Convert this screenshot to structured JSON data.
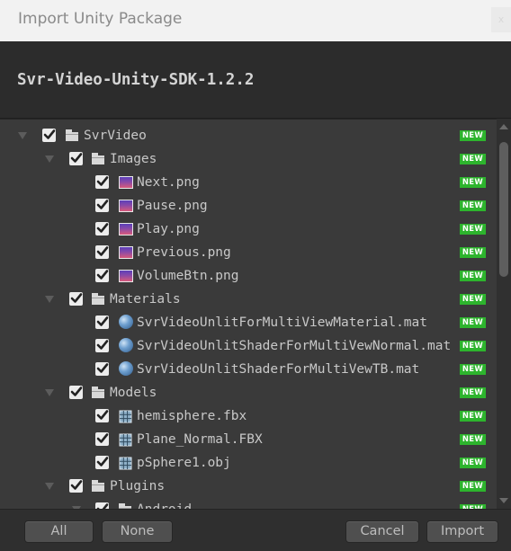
{
  "window": {
    "title": "Import Unity Package",
    "close_glyph": "x"
  },
  "package": {
    "name": "Svr-Video-Unity-SDK-1.2.2"
  },
  "badge": {
    "new_label": "NEW",
    "color": "#2db42d"
  },
  "tree": [
    {
      "label": "SvrVideo",
      "icon": "folder-icon",
      "depth": 0,
      "expanded": true,
      "checked": true,
      "new": true
    },
    {
      "label": "Images",
      "icon": "folder-icon",
      "depth": 1,
      "expanded": true,
      "checked": true,
      "new": true
    },
    {
      "label": "Next.png",
      "icon": "image-icon",
      "depth": 2,
      "checked": true,
      "new": true
    },
    {
      "label": "Pause.png",
      "icon": "image-icon",
      "depth": 2,
      "checked": true,
      "new": true
    },
    {
      "label": "Play.png",
      "icon": "image-icon",
      "depth": 2,
      "checked": true,
      "new": true
    },
    {
      "label": "Previous.png",
      "icon": "image-icon",
      "depth": 2,
      "checked": true,
      "new": true
    },
    {
      "label": "VolumeBtn.png",
      "icon": "image-icon",
      "depth": 2,
      "checked": true,
      "new": true
    },
    {
      "label": "Materials",
      "icon": "folder-icon",
      "depth": 1,
      "expanded": true,
      "checked": true,
      "new": true
    },
    {
      "label": "SvrVideoUnlitForMultiViewMaterial.mat",
      "icon": "material-sphere-icon",
      "depth": 2,
      "checked": true,
      "new": true
    },
    {
      "label": "SvrVideoUnlitShaderForMultiVewNormal.mat",
      "icon": "material-sphere-icon",
      "depth": 2,
      "checked": true,
      "new": true
    },
    {
      "label": "SvrVideoUnlitShaderForMultiVewTB.mat",
      "icon": "material-sphere-icon",
      "depth": 2,
      "checked": true,
      "new": true
    },
    {
      "label": "Models",
      "icon": "folder-icon",
      "depth": 1,
      "expanded": true,
      "checked": true,
      "new": true
    },
    {
      "label": "hemisphere.fbx",
      "icon": "mesh-icon",
      "depth": 2,
      "checked": true,
      "new": true
    },
    {
      "label": "Plane_Normal.FBX",
      "icon": "mesh-icon",
      "depth": 2,
      "checked": true,
      "new": true
    },
    {
      "label": "pSphere1.obj",
      "icon": "mesh-icon",
      "depth": 2,
      "checked": true,
      "new": true
    },
    {
      "label": "Plugins",
      "icon": "folder-icon",
      "depth": 1,
      "expanded": true,
      "checked": true,
      "new": true
    },
    {
      "label": "Android",
      "icon": "folder-icon",
      "depth": 2,
      "expanded": true,
      "checked": true,
      "new": true
    }
  ],
  "footer": {
    "all_label": "All",
    "none_label": "None",
    "cancel_label": "Cancel",
    "import_label": "Import"
  }
}
